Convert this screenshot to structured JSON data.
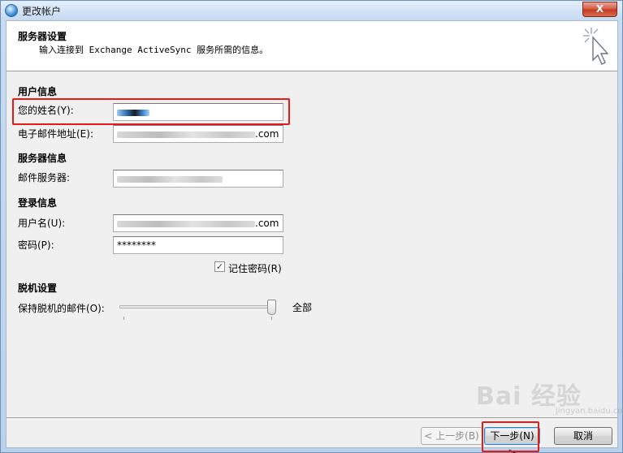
{
  "window": {
    "title": "更改帐户",
    "close_label": "X"
  },
  "header": {
    "title": "服务器设置",
    "description": "输入连接到 Exchange ActiveSync 服务所需的信息。",
    "icon": "wizard-cursor-icon"
  },
  "user_info": {
    "section": "用户信息",
    "name_label": "您的姓名(Y):",
    "email_label": "电子邮件地址(E):",
    "email_suffix": ".com"
  },
  "server_info": {
    "section": "服务器信息",
    "server_label": "邮件服务器:"
  },
  "login_info": {
    "section": "登录信息",
    "username_label": "用户名(U):",
    "username_suffix": ".com",
    "password_label": "密码(P):",
    "password_value": "********",
    "remember_label": "记住密码(R)",
    "remember_checked": true
  },
  "offline": {
    "section": "脱机设置",
    "keep_label": "保持脱机的邮件(O):",
    "slider_value_label": "全部"
  },
  "buttons": {
    "back": "< 上一步(B)",
    "next": "下一步(N) >",
    "cancel": "取消"
  },
  "watermark": {
    "text": "Bai 经验",
    "sub": "jingyan.baidu.com"
  },
  "colors": {
    "highlight": "#e41b17",
    "accent": "#3c7fb1"
  }
}
